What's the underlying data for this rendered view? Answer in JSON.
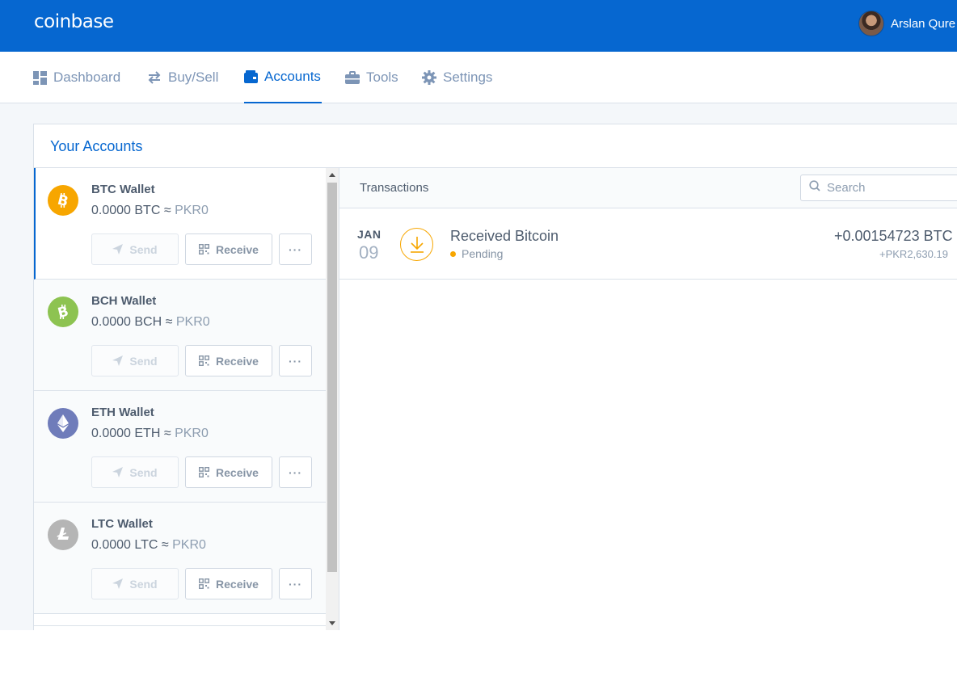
{
  "topbar": {
    "logo": "coinbase",
    "user_name": "Arslan Qure"
  },
  "nav": {
    "items": [
      {
        "label": "Dashboard",
        "icon": "dashboard-icon"
      },
      {
        "label": "Buy/Sell",
        "icon": "swap-arrows-icon"
      },
      {
        "label": "Accounts",
        "icon": "wallet-icon",
        "active": true
      },
      {
        "label": "Tools",
        "icon": "briefcase-icon"
      },
      {
        "label": "Settings",
        "icon": "gear-icon"
      }
    ]
  },
  "accounts": {
    "title": "Your Accounts",
    "wallets": [
      {
        "name": "BTC Wallet",
        "balance": "0.0000 BTC",
        "approx": "≈",
        "fiat": "PKR0",
        "coin_color": "#f7a600",
        "icon": "bitcoin-icon"
      },
      {
        "name": "BCH Wallet",
        "balance": "0.0000 BCH",
        "approx": "≈",
        "fiat": "PKR0",
        "coin_color": "#8dc351",
        "icon": "bitcoin-cash-icon"
      },
      {
        "name": "ETH Wallet",
        "balance": "0.0000 ETH",
        "approx": "≈",
        "fiat": "PKR0",
        "coin_color": "#6f7cba",
        "icon": "ethereum-icon"
      },
      {
        "name": "LTC Wallet",
        "balance": "0.0000 LTC",
        "approx": "≈",
        "fiat": "PKR0",
        "coin_color": "#b5b5b5",
        "icon": "litecoin-icon"
      }
    ],
    "send_label": "Send",
    "receive_label": "Receive",
    "more_label": "···"
  },
  "transactions": {
    "title": "Transactions",
    "search_placeholder": "Search",
    "items": [
      {
        "month": "JAN",
        "day": "09",
        "title": "Received Bitcoin",
        "status": "Pending",
        "amount": "+0.00154723 BTC",
        "fiat": "+PKR2,630.19"
      }
    ]
  },
  "colors": {
    "brand": "#0667d0",
    "pending": "#f7a600"
  }
}
